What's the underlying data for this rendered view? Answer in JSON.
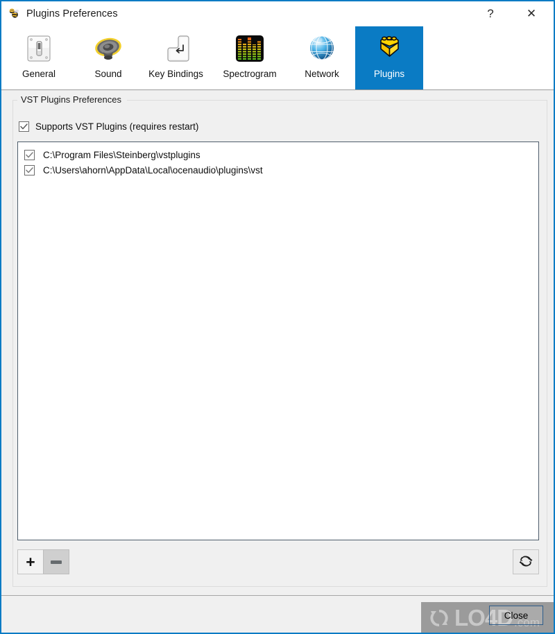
{
  "window": {
    "title": "Plugins Preferences",
    "icon": "bee-icon",
    "border_color": "#0a7bc4",
    "background": "#f0f0f0"
  },
  "titlebar": {
    "help_glyph": "?",
    "close_glyph": "✕",
    "help_name": "help-button",
    "close_name": "close-window-button"
  },
  "toolbar": {
    "selected_index": 5,
    "accent_color": "#0a7bc4",
    "tabs": [
      {
        "label": "General",
        "icon": "light-switch-icon"
      },
      {
        "label": "Sound",
        "icon": "speaker-icon"
      },
      {
        "label": "Key Bindings",
        "icon": "enter-key-icon"
      },
      {
        "label": "Spectrogram",
        "icon": "spectrogram-bars-icon"
      },
      {
        "label": "Network",
        "icon": "globe-icon"
      },
      {
        "label": "Plugins",
        "icon": "lego-brick-icon"
      }
    ]
  },
  "main": {
    "groupbox_title": "VST Plugins Preferences",
    "supports_checkbox": {
      "label": "Supports VST Plugins (requires restart)",
      "checked": true
    },
    "plugin_paths": [
      {
        "path": "C:\\Program Files\\Steinberg\\vstplugins",
        "checked": true
      },
      {
        "path": "C:\\Users\\ahorn\\AppData\\Local\\ocenaudio\\plugins\\vst",
        "checked": true
      }
    ],
    "buttons": {
      "add": {
        "glyph": "+",
        "name": "add-path-button",
        "enabled": true
      },
      "remove": {
        "glyph": "—",
        "name": "remove-path-button",
        "enabled": false
      },
      "refresh": {
        "name": "refresh-plugins-button",
        "enabled": true
      }
    }
  },
  "footer": {
    "close_label": "Close"
  },
  "watermark": {
    "text_main": "LO4D",
    "text_suffix": ".com",
    "band_color": "#9b9b9b"
  }
}
